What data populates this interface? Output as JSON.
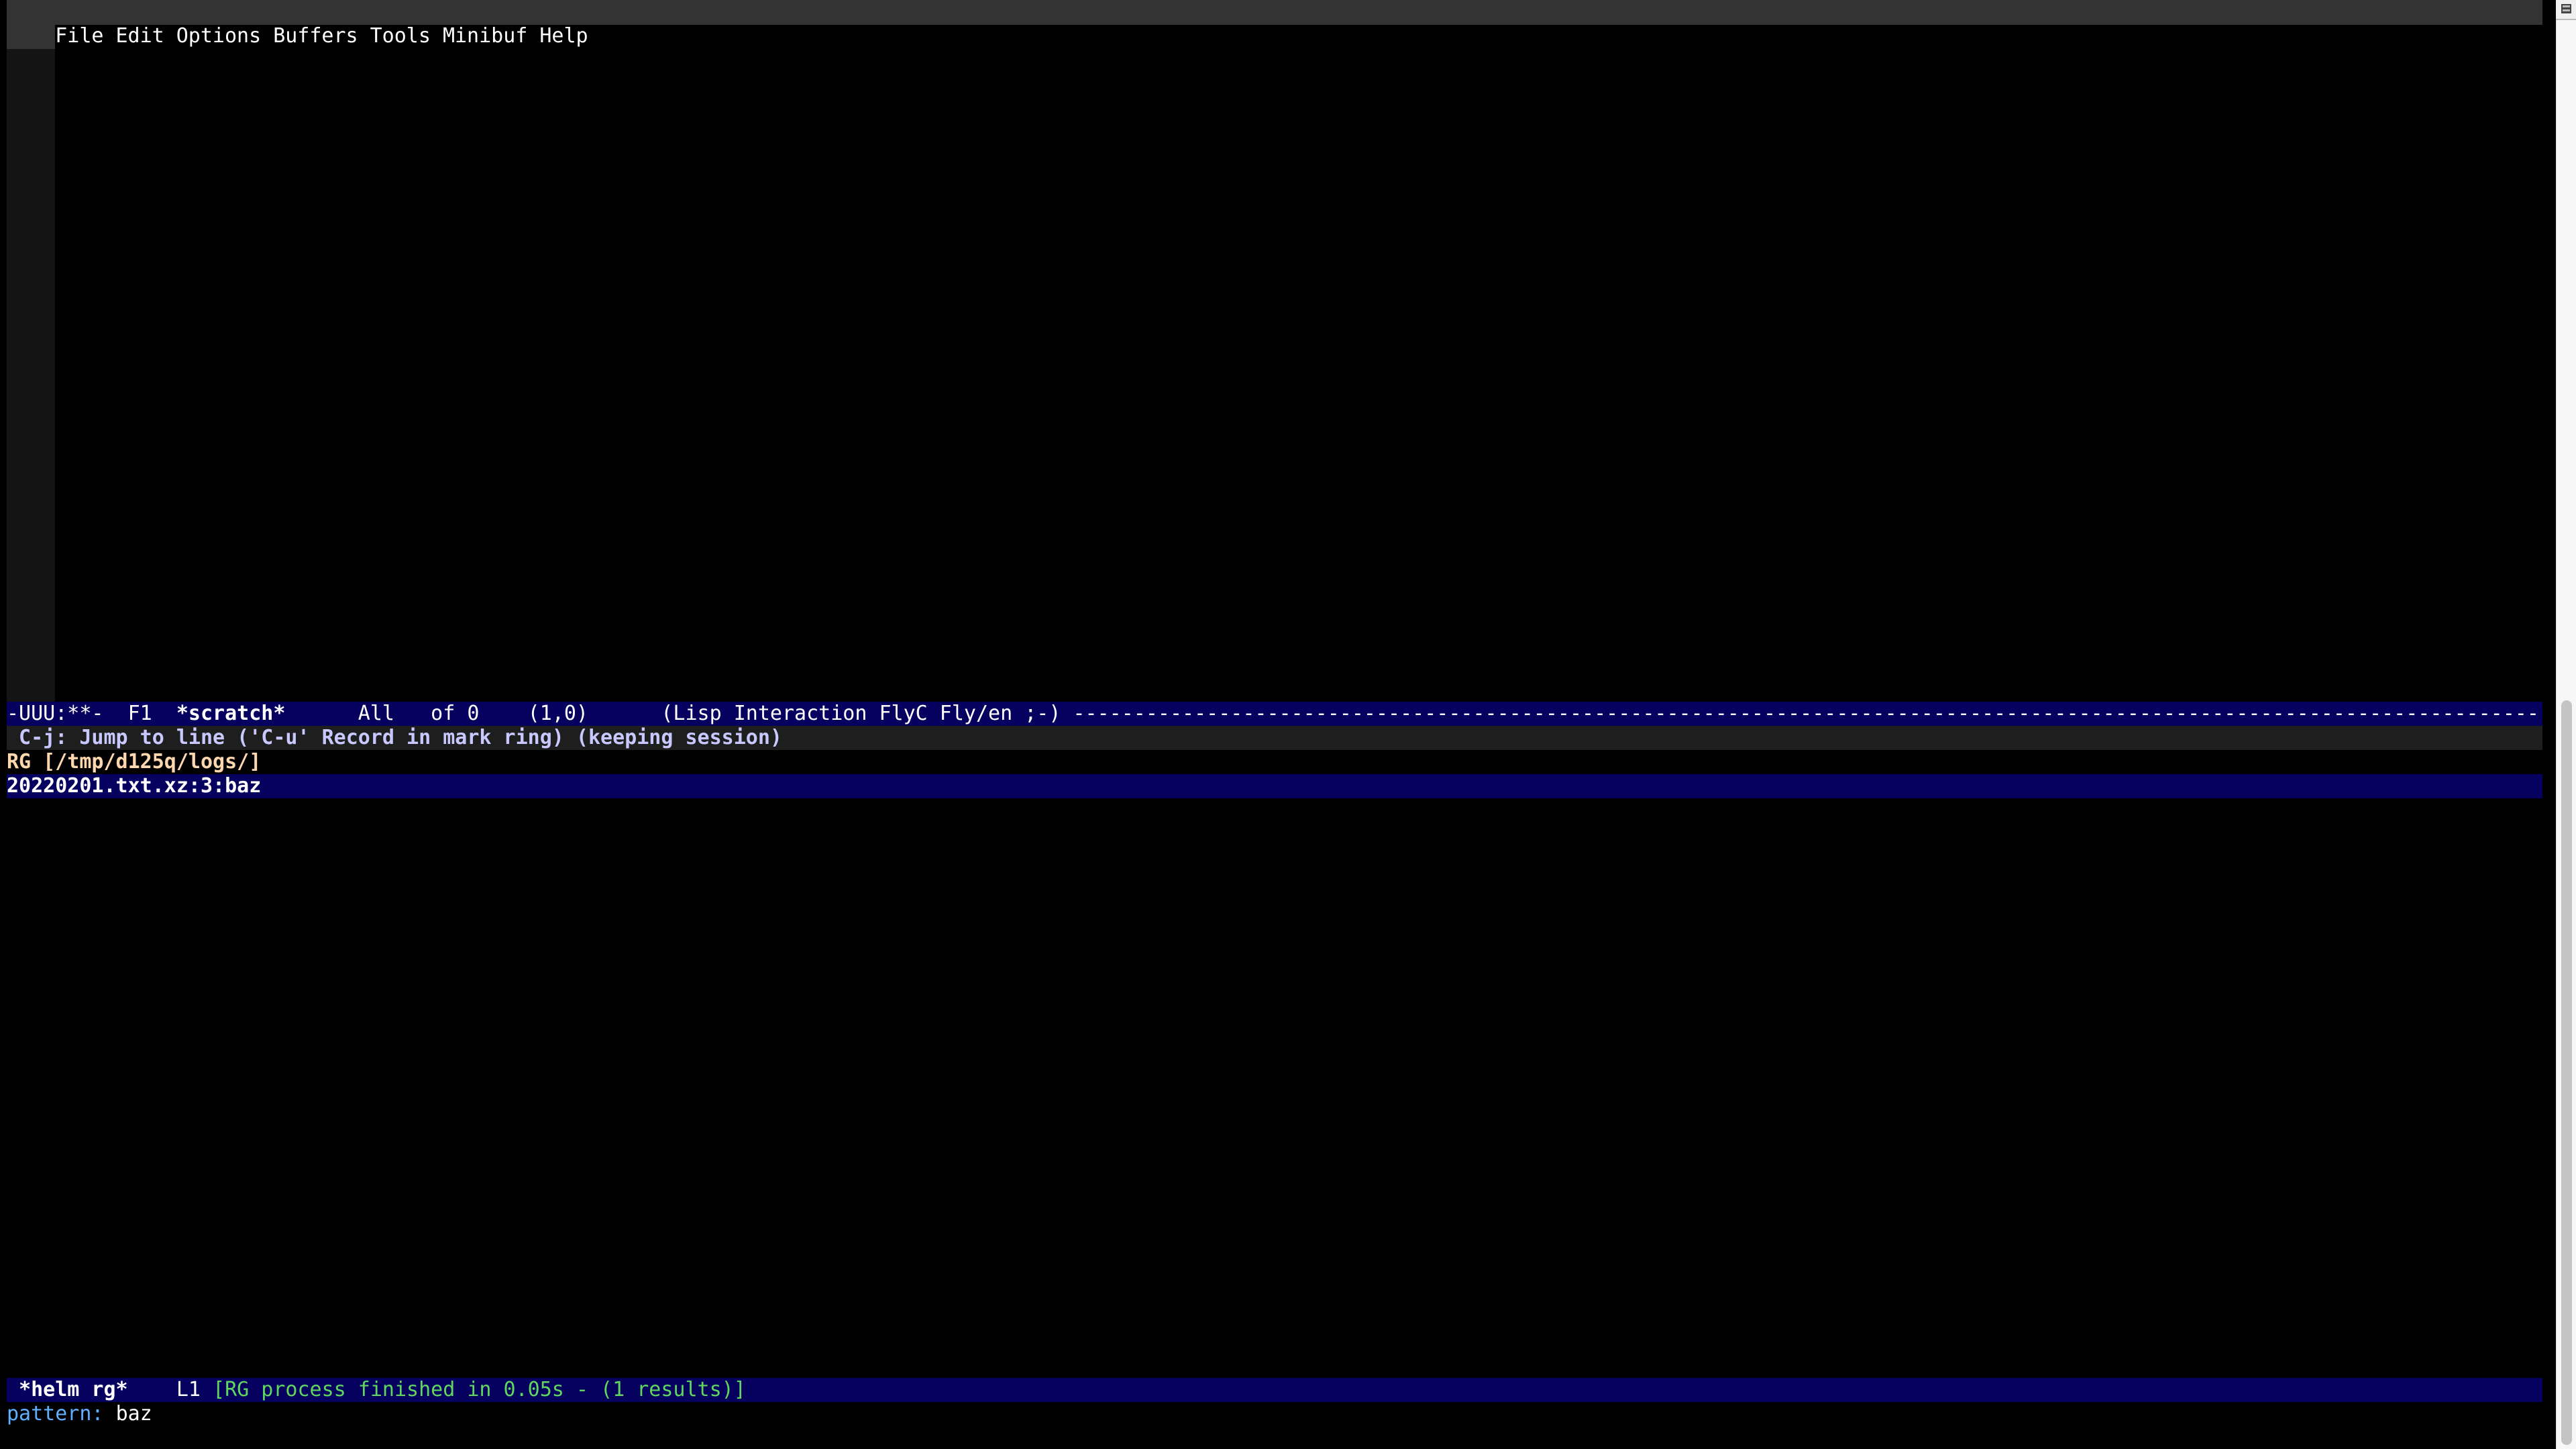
{
  "menubar": {
    "items": [
      "File",
      "Edit",
      "Options",
      "Buffers",
      "Tools",
      "Minibuf",
      "Help"
    ]
  },
  "modeline": {
    "status": "-UUU:**-  F1  ",
    "buffer_name": "*scratch*",
    "position": "      All   of 0    (1,0)      ",
    "modes": "(Lisp Interaction FlyC Fly/en ;-) ",
    "filler": "-------------------------------------------------------------------------------------------------------------------------------------------------------------------------------------------------"
  },
  "help_line": " C-j: Jump to line ('C-u' Record in mark ring) (keeping session)",
  "helm": {
    "source_header": "RG [/tmp/d125q/logs/]",
    "results": [
      "20220201.txt.xz:3:baz"
    ],
    "selected_index": 0,
    "modeline": {
      "buffer_name": " *helm rg*",
      "line": "    L1 ",
      "status": "[RG process finished in 0.05s - (1 results)]"
    }
  },
  "minibuffer": {
    "prompt": "pattern: ",
    "input": "baz"
  },
  "colors": {
    "modeline_bg": "#06005f",
    "menubar_bg": "#333333",
    "header_fg": "#ffd7af",
    "status_fg": "#5fd75f",
    "prompt_fg": "#5fafff",
    "help_fg": "#c8c8ff"
  }
}
